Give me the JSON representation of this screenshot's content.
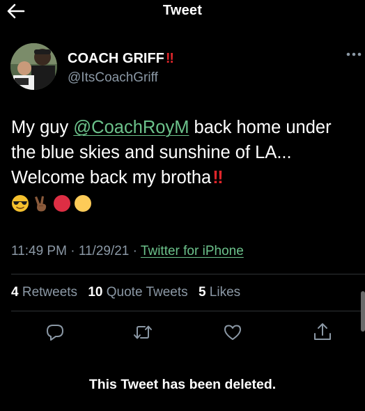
{
  "header": {
    "title": "Tweet"
  },
  "author": {
    "display_name": "COACH GRIFF",
    "name_emoji": "‼",
    "handle": "@ItsCoachGriff"
  },
  "tweet": {
    "line1_pre": "My guy ",
    "mention": "@CoachRoyM",
    "line1_post": " back home under the blue skies and sunshine of LA... Welcome back my brotha",
    "text_emoji": "‼",
    "emojis": [
      "sunglasses-face",
      "victory-hand",
      "red-circle",
      "yellow-circle"
    ]
  },
  "meta": {
    "time": "11:49 PM",
    "separator": "·",
    "date": "11/29/21",
    "source": "Twitter for iPhone"
  },
  "stats": {
    "retweets_count": "4",
    "retweets_label": "Retweets",
    "quotes_count": "10",
    "quotes_label": "Quote Tweets",
    "likes_count": "5",
    "likes_label": "Likes"
  },
  "actions": [
    "reply-icon",
    "retweet-icon",
    "like-icon",
    "share-icon"
  ],
  "quoted_notice": "This Tweet has been deleted.",
  "colors": {
    "background": "#000000",
    "accent": "#6cc28b",
    "muted": "#8b98a5",
    "alert": "#e0262b"
  }
}
